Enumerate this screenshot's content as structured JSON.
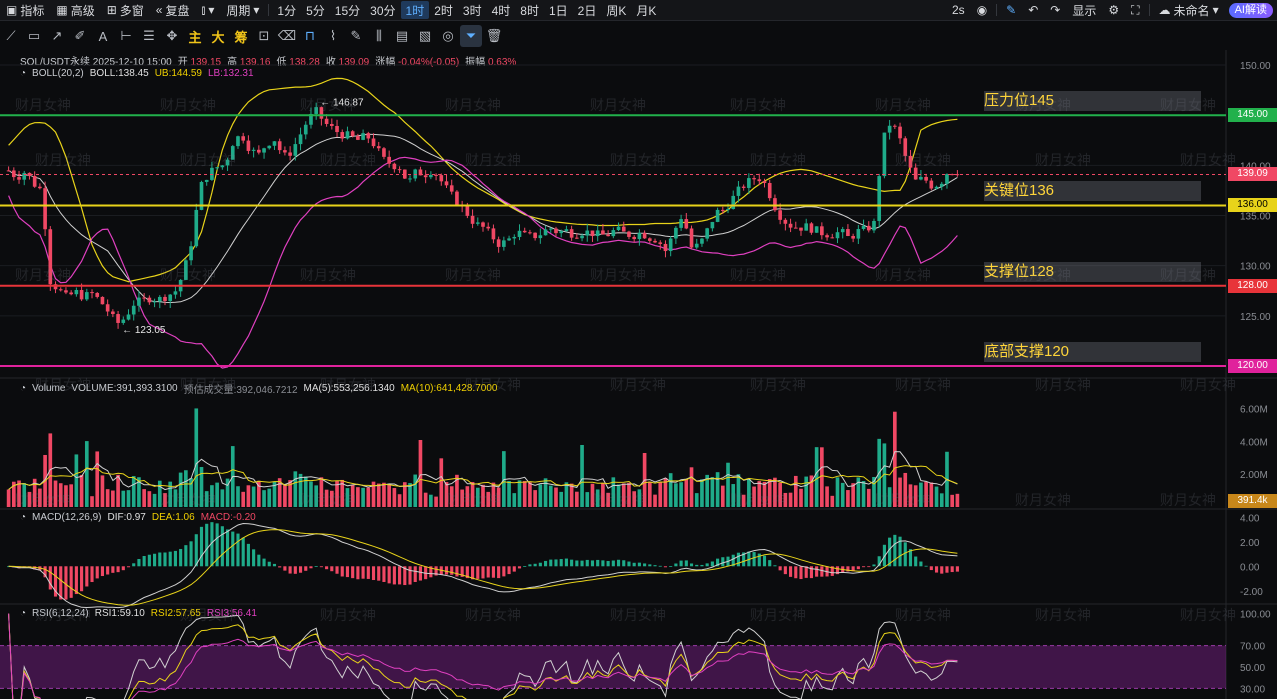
{
  "toolbar": {
    "indicators": "指标",
    "advanced": "高级",
    "multi_window": "多窗",
    "replay": "复盘",
    "period": "周期",
    "intervals": [
      "1分",
      "5分",
      "15分",
      "30分",
      "1时",
      "2时",
      "3时",
      "4时",
      "8时",
      "1日",
      "2日",
      "周K",
      "月K"
    ],
    "active_interval": "1时",
    "refresh": "2s",
    "display": "显示",
    "layout_name": "未命名",
    "ai": "AI解读"
  },
  "drawing_tools": {
    "main": "主",
    "large": "大",
    "chips": "筹"
  },
  "header": {
    "symbol_line": "SOL/USDT永续 2025-12-10 15:00",
    "open_label": "开",
    "open": "139.15",
    "high_label": "高",
    "high": "139.16",
    "low_label": "低",
    "low": "138.28",
    "close_label": "收",
    "close": "139.09",
    "chg_label": "涨幅",
    "chg": "-0.04%(-0.05)",
    "amp_label": "振幅",
    "amp": "0.63%"
  },
  "boll": {
    "name": "BOLL(20,2)",
    "boll": "BOLL:138.45",
    "ub": "UB:144.59",
    "lb": "LB:132.31"
  },
  "volume_header": {
    "name": "Volume",
    "volume": "VOLUME:391,393.3100",
    "est": "预估成交量:392,046.7212",
    "ma5": "MA(5):553,256.1340",
    "ma10": "MA(10):641,428.7000"
  },
  "macd_header": {
    "name": "MACD(12,26,9)",
    "dif": "DIF:0.97",
    "dea": "DEA:1.06",
    "macd": "MACD:-0.20"
  },
  "rsi_header": {
    "name": "RSI(6,12,24)",
    "rsi1": "RSI1:59.10",
    "rsi2": "RSI2:57.65",
    "rsi3": "RSI3:56.41"
  },
  "levels": [
    {
      "label": "压力位145",
      "price": "145.00",
      "value": 145,
      "color": "#22b14c"
    },
    {
      "label": "关键位136",
      "price": "136.00",
      "value": 136,
      "color": "#e8d31a"
    },
    {
      "label": "支撑位128",
      "price": "128.00",
      "value": 128,
      "color": "#e8343a"
    },
    {
      "label": "底部支撑120",
      "price": "120.00",
      "value": 120,
      "color": "#e0229c"
    }
  ],
  "current_price": "139.09",
  "volume_tag": "391.4k",
  "watermark": "财月女神",
  "chart_data": [
    {
      "type": "candlestick",
      "title": "SOL/USDT永续",
      "interval": "1时",
      "y_ticks": [
        "150.00",
        "145.00",
        "140.00",
        "135.00",
        "130.00",
        "125.00",
        "120.00"
      ],
      "ylim": [
        119,
        151.5
      ],
      "high_annotation": "146.87",
      "low_annotation": "123.05",
      "close_path": [
        139.5,
        138.8,
        139.4,
        138.2,
        137.5,
        128.5,
        127.6,
        126.8,
        127.4,
        126.9,
        127.2,
        126.5,
        125.4,
        124.2,
        124.8,
        126.2,
        126.5,
        126.8,
        126.6,
        127.0,
        127.4,
        129.2,
        132.5,
        137.8,
        139.2,
        139.8,
        140.1,
        142.4,
        143.1,
        141.6,
        141.0,
        142.2,
        142.6,
        140.8,
        141.4,
        143.0,
        144.6,
        145.4,
        144.2,
        143.6,
        143.1,
        142.9,
        142.5,
        143.0,
        142.0,
        140.6,
        140.1,
        139.8,
        138.2,
        139.4,
        139.1,
        139.6,
        138.4,
        137.2,
        136.3,
        135.3,
        134.2,
        133.8,
        133.0,
        132.1,
        132.5,
        133.4,
        133.0,
        132.9,
        133.2,
        133.8,
        133.3,
        133.5,
        133.1,
        133.4,
        133.3,
        133.0,
        133.1,
        133.6,
        133.2,
        133.0,
        133.3,
        132.8,
        132.6,
        131.4,
        133.5,
        135.2,
        131.8,
        132.0,
        133.6,
        135.3,
        135.6,
        136.7,
        137.8,
        138.4,
        138.9,
        138.0,
        136.0,
        134.6,
        134.0,
        133.8,
        133.9,
        133.5,
        133.2,
        133.1,
        133.4,
        132.7,
        133.4,
        133.6,
        134.2,
        142.4,
        144.4,
        142.8,
        140.2,
        138.4,
        138.7,
        137.9,
        138.3,
        139.6,
        139.09
      ],
      "boll_ub": [
        142,
        143,
        144,
        144.3,
        144.2,
        143.5,
        141.5,
        138.5,
        135.5,
        132.2,
        130.2,
        129.0,
        128.7,
        128.4,
        128.6,
        128.8,
        129.0,
        129.3,
        129.7,
        130.6,
        131.5,
        133.5,
        137.0,
        141.0,
        143.6,
        145.2,
        146.3,
        147.0,
        147.5,
        147.6,
        147.7,
        147.8,
        147.8,
        147.9,
        148.2,
        148.6,
        148.7,
        148.5,
        148.0,
        147.4,
        146.6,
        145.8,
        145.2,
        144.3,
        143.5,
        142.6,
        141.8,
        140.8,
        139.8,
        139.0,
        138.3,
        137.7,
        137.2,
        136.7,
        136.1,
        135.6,
        135.1,
        134.8,
        134.6,
        134.4,
        134.3,
        134.2,
        134.1,
        134.1,
        134.0,
        134.0,
        134.0,
        134.1,
        134.1,
        134.1,
        134.2,
        134.2,
        134.2,
        134.3,
        134.3,
        134.4,
        134.6,
        135.0,
        135.5,
        136.3,
        137.0,
        137.8,
        138.4,
        138.9,
        139.3,
        139.5,
        139.6,
        139.5,
        139.2,
        138.9,
        138.6,
        138.3,
        138.0,
        137.8,
        137.6,
        137.4,
        137.5,
        137.5,
        140.2,
        143.5,
        144.0,
        144.3,
        144.5,
        144.59
      ]
    },
    {
      "type": "bar",
      "title": "Volume",
      "y_ticks": [
        "6.00M",
        "4.00M",
        "2.00M"
      ],
      "ylim": [
        0,
        7000000
      ]
    },
    {
      "type": "line",
      "title": "MACD(12,26,9)",
      "y_ticks": [
        "4.00",
        "2.00",
        "0.00",
        "-2.00"
      ],
      "ylim": [
        -3.0,
        4.6
      ]
    },
    {
      "type": "line",
      "title": "RSI(6,12,24)",
      "y_ticks": [
        "100.00",
        "70.00",
        "50.00",
        "30.00"
      ],
      "ylim": [
        20,
        108
      ],
      "band": [
        30,
        70
      ]
    }
  ]
}
